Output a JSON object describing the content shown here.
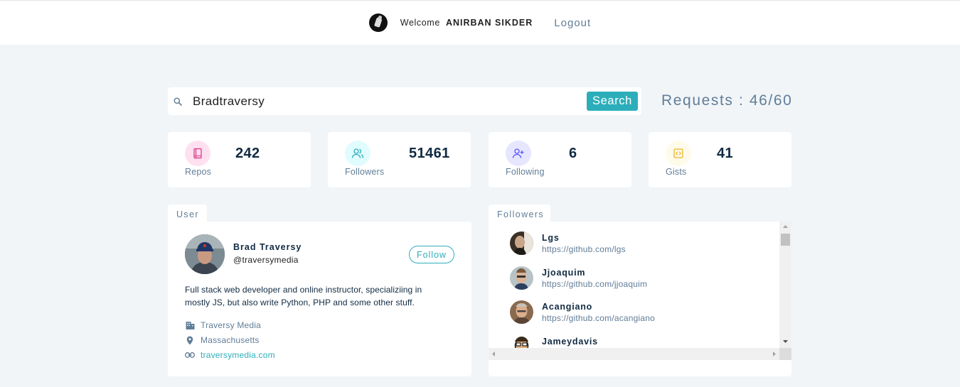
{
  "navbar": {
    "welcome_text": "Welcome",
    "user_name": "ANIRBAN SIKDER",
    "logout_label": "Logout"
  },
  "search": {
    "value": "Bradtraversy",
    "button_label": "Search"
  },
  "requests": {
    "text": "Requests : 46/60"
  },
  "stats": [
    {
      "label": "Repos",
      "value": "242",
      "icon": "book-icon",
      "color": "#da4a91",
      "bg": "#ffe0f0"
    },
    {
      "label": "Followers",
      "value": "51461",
      "icon": "users-icon",
      "color": "#2caeba",
      "bg": "#e0fcff"
    },
    {
      "label": "Following",
      "value": "6",
      "icon": "user-plus-icon",
      "color": "#5d55fa",
      "bg": "#e6e6ff"
    },
    {
      "label": "Gists",
      "value": "41",
      "icon": "code-icon",
      "color": "#f0b429",
      "bg": "#fffbea"
    }
  ],
  "user_card": {
    "tab_label": "User",
    "name": "Brad Traversy",
    "handle": "@traversymedia",
    "follow_label": "Follow",
    "bio": "Full stack web developer and online instructor, specializiing in mostly JS, but also write Python, PHP and some other stuff.",
    "company": "Traversy Media",
    "location": "Massachusetts",
    "blog": "traversymedia.com"
  },
  "followers_card": {
    "tab_label": "Followers",
    "items": [
      {
        "login": "Lgs",
        "url": "https://github.com/lgs"
      },
      {
        "login": "Jjoaquim",
        "url": "https://github.com/jjoaquim"
      },
      {
        "login": "Acangiano",
        "url": "https://github.com/acangiano"
      },
      {
        "login": "Jameydavis",
        "url": ""
      }
    ]
  },
  "colors": {
    "primary": "#2caeba",
    "background": "#f1f5f8",
    "text_dark": "#102a42",
    "text_muted": "#617d98"
  }
}
